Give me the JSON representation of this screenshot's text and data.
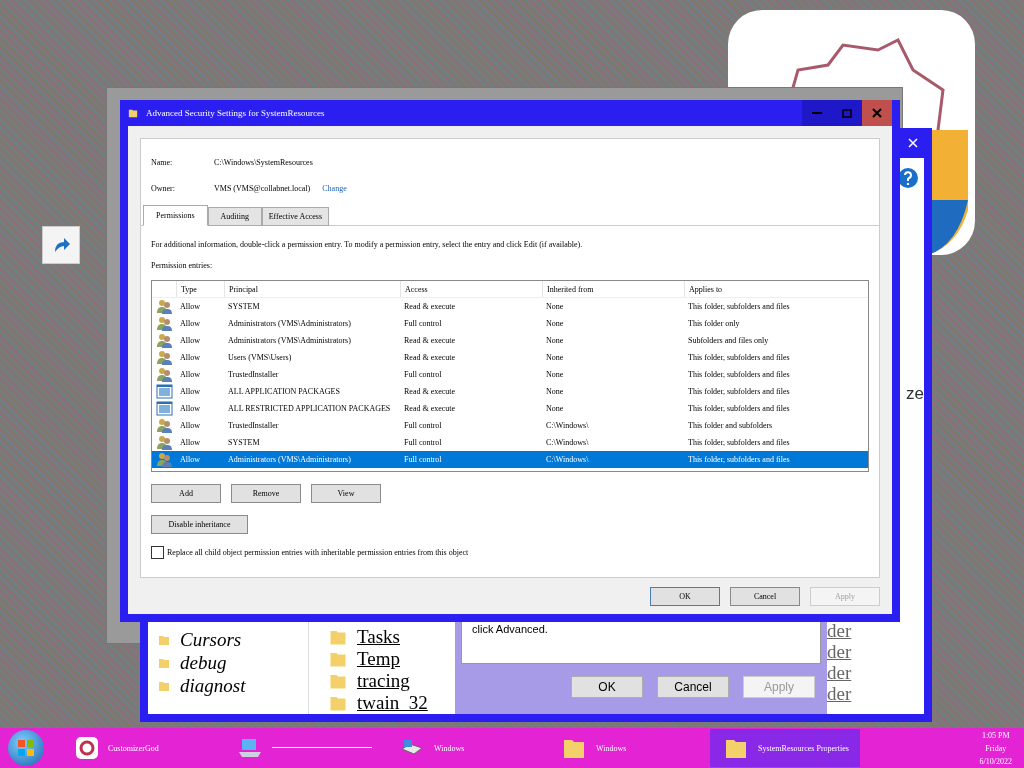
{
  "back_window": {
    "tree_items": [
      "Cursors",
      "debug",
      "diagnost"
    ],
    "files": [
      "Tasks",
      "Temp",
      "tracing",
      "twain_32"
    ],
    "hint": "click Advanced.",
    "buttons": [
      {
        "label": "OK",
        "disabled": false
      },
      {
        "label": "Cancel",
        "disabled": false
      },
      {
        "label": "Apply",
        "disabled": true
      }
    ],
    "column_fragments": [
      "der",
      "der",
      "der",
      "der"
    ],
    "side_fragment": "ze"
  },
  "dialog": {
    "title": "Advanced Security Settings for SystemResources",
    "name_label": "Name:",
    "name_value": "C:\\Windows\\SystemResources",
    "owner_label": "Owner:",
    "owner_value": "VMS (VMS@collabnet.local)",
    "change_link": "Change",
    "tabs": [
      {
        "label": "Permissions",
        "selected": true
      },
      {
        "label": "Auditing",
        "selected": false
      },
      {
        "label": "Effective Access",
        "selected": false
      }
    ],
    "info": "For additional information, double-click a permission entry. To modify a permission entry, select the entry and click Edit (if available).",
    "entries_label": "Permission entries:",
    "columns": [
      "Type",
      "Principal",
      "Access",
      "Inherited from",
      "Applies to"
    ],
    "rows": [
      {
        "kind": "user",
        "type": "Allow",
        "principal": "SYSTEM",
        "access": "Read & execute",
        "inherited_from": "None",
        "applies_to": "This folder, subfolders and files",
        "selected": false
      },
      {
        "kind": "user",
        "type": "Allow",
        "principal": "Administrators (VMS\\Administrators)",
        "access": "Full control",
        "inherited_from": "None",
        "applies_to": "This folder only",
        "selected": false
      },
      {
        "kind": "user",
        "type": "Allow",
        "principal": "Administrators (VMS\\Administrators)",
        "access": "Read & execute",
        "inherited_from": "None",
        "applies_to": "Subfolders and files only",
        "selected": false
      },
      {
        "kind": "user",
        "type": "Allow",
        "principal": "Users (VMS\\Users)",
        "access": "Read & execute",
        "inherited_from": "None",
        "applies_to": "This folder, subfolders and files",
        "selected": false
      },
      {
        "kind": "user",
        "type": "Allow",
        "principal": "TrustedInstaller",
        "access": "Full control",
        "inherited_from": "None",
        "applies_to": "This folder, subfolders and files",
        "selected": false
      },
      {
        "kind": "package",
        "type": "Allow",
        "principal": "ALL APPLICATION PACKAGES",
        "access": "Read & execute",
        "inherited_from": "None",
        "applies_to": "This folder, subfolders and files",
        "selected": false
      },
      {
        "kind": "package",
        "type": "Allow",
        "principal": "ALL RESTRICTED APPLICATION PACKAGES",
        "access": "Read & execute",
        "inherited_from": "None",
        "applies_to": "This folder, subfolders and files",
        "selected": false
      },
      {
        "kind": "user",
        "type": "Allow",
        "principal": "TrustedInstaller",
        "access": "Full control",
        "inherited_from": "C:\\Windows\\",
        "applies_to": "This folder and subfolders",
        "selected": false
      },
      {
        "kind": "user",
        "type": "Allow",
        "principal": "SYSTEM",
        "access": "Full control",
        "inherited_from": "C:\\Windows\\",
        "applies_to": "This folder, subfolders and files",
        "selected": false
      },
      {
        "kind": "user",
        "type": "Allow",
        "principal": "Administrators (VMS\\Administrators)",
        "access": "Full control",
        "inherited_from": "C:\\Windows\\",
        "applies_to": "This folder, subfolders and files",
        "selected": true
      }
    ],
    "entry_buttons": [
      "Add",
      "Remove",
      "View"
    ],
    "disable_inheritance": "Disable inheritance",
    "replace_checkbox": {
      "label": "Replace all child object permission entries with inheritable permission entries from this object",
      "checked": false
    },
    "footer_buttons": [
      {
        "label": "OK",
        "disabled": false
      },
      {
        "label": "Cancel",
        "disabled": false
      },
      {
        "label": "Apply",
        "disabled": true
      }
    ]
  },
  "taskbar": {
    "items": [
      {
        "kind": "gear",
        "label": "CustomizerGod",
        "selected": false
      },
      {
        "kind": "computer",
        "selected": false
      },
      {
        "kind": "drive",
        "label": "Windows",
        "selected": false
      },
      {
        "kind": "folder",
        "label": "Windows",
        "selected": false
      },
      {
        "kind": "folder",
        "label": "SystemResources Properties",
        "selected": true
      }
    ],
    "clock": {
      "time": "1:05 PM",
      "day": "Friday",
      "date": "6/10/2022"
    }
  }
}
